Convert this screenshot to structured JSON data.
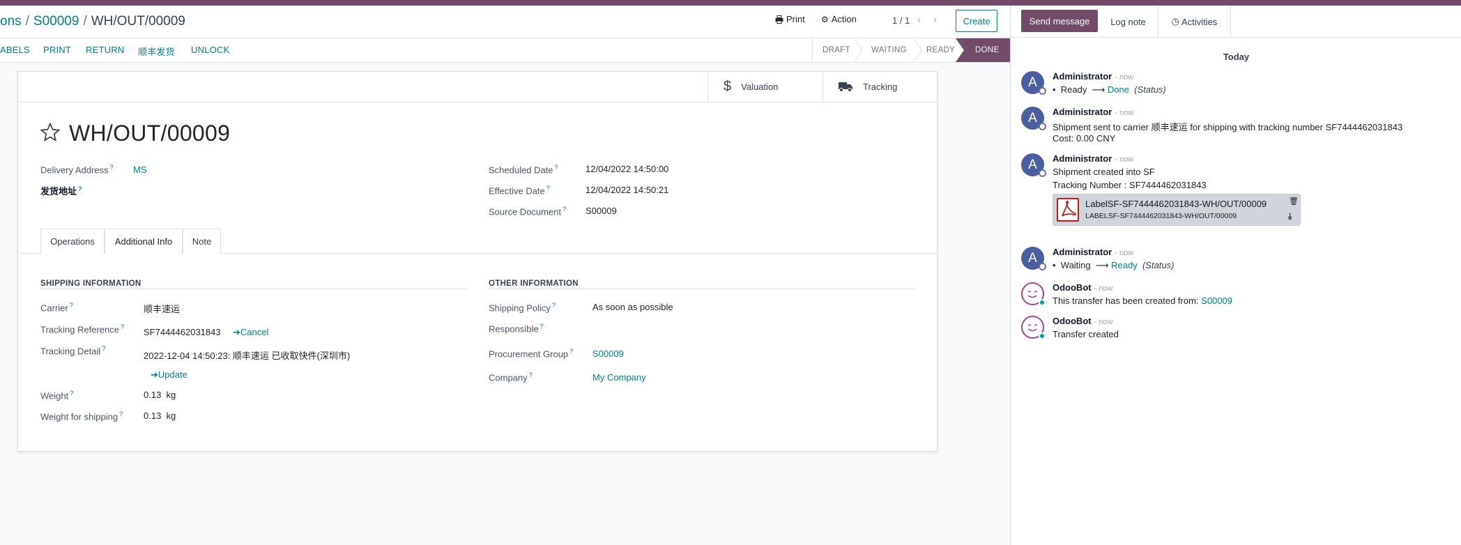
{
  "breadcrumb": {
    "parent1": "ons",
    "parent2": "S00009",
    "current": "WH/OUT/00009"
  },
  "control": {
    "print": "Print",
    "action": "Action",
    "pager": "1 / 1",
    "create": "Create"
  },
  "actions": [
    "ABELS",
    "PRINT",
    "RETURN",
    "顺丰发货",
    "UNLOCK"
  ],
  "statusbar": [
    "DRAFT",
    "WAITING",
    "READY",
    "DONE"
  ],
  "smart_buttons": {
    "valuation": "Valuation",
    "tracking": "Tracking"
  },
  "record": {
    "title": "WH/OUT/00009",
    "delivery_address_label": "Delivery Address",
    "delivery_address_value": "MS",
    "ship_from_label": "发货地址",
    "scheduled_date_label": "Scheduled Date",
    "scheduled_date_value": "12/04/2022 14:50:00",
    "effective_date_label": "Effective Date",
    "effective_date_value": "12/04/2022 14:50:21",
    "source_document_label": "Source Document",
    "source_document_value": "S00009"
  },
  "tabs": [
    "Operations",
    "Additional Info",
    "Note"
  ],
  "shipping": {
    "title": "SHIPPING INFORMATION",
    "carrier_label": "Carrier",
    "carrier_value": "顺丰速运",
    "tracking_ref_label": "Tracking Reference",
    "tracking_ref_value": "SF7444462031843",
    "cancel": "Cancel",
    "tracking_detail_label": "Tracking Detail",
    "tracking_detail_value": "2022-12-04 14:50:23: 顺丰速运 已收取快件(深圳市)",
    "update": "Update",
    "weight_label": "Weight",
    "weight_value": "0.13",
    "weight_unit": "kg",
    "weight_shipping_label": "Weight for shipping",
    "weight_shipping_value": "0.13",
    "weight_shipping_unit": "kg"
  },
  "other": {
    "title": "OTHER INFORMATION",
    "shipping_policy_label": "Shipping Policy",
    "shipping_policy_value": "As soon as possible",
    "responsible_label": "Responsible",
    "procurement_label": "Procurement Group",
    "procurement_value": "S00009",
    "company_label": "Company",
    "company_value": "My Company"
  },
  "chatter": {
    "send_message": "Send message",
    "log_note": "Log note",
    "activities": "Activities",
    "today": "Today",
    "messages": [
      {
        "author": "Administrator",
        "when": "- now",
        "avatar": "A",
        "line1_from": "Ready",
        "line1_to": "Done",
        "line1_field": "(Status)"
      },
      {
        "author": "Administrator",
        "when": "- now",
        "avatar": "A",
        "line1": "Shipment sent to carrier 顺丰速运 for shipping with tracking number SF7444462031843",
        "line2": "Cost: 0.00 CNY"
      },
      {
        "author": "Administrator",
        "when": "- now",
        "avatar": "A",
        "line1": "Shipment created into SF",
        "line2": "Tracking Number : SF7444462031843",
        "attachment_name": "LabelSF-SF7444462031843-WH/OUT/00009",
        "attachment_sub": "LABELSF-SF7444462031843-WH/OUT/00009"
      },
      {
        "author": "Administrator",
        "when": "- now",
        "avatar": "A",
        "line1_from": "Waiting",
        "line1_to": "Ready",
        "line1_field": "(Status)"
      },
      {
        "author": "OdooBot",
        "when": "- now",
        "line1": "This transfer has been created from: ",
        "line1_link": "S00009"
      },
      {
        "author": "OdooBot",
        "when": "- now",
        "line1": "Transfer created"
      }
    ]
  },
  "colors": {
    "brand": "#714b67",
    "link": "#017e84",
    "avatar": "#4b5ea0"
  }
}
